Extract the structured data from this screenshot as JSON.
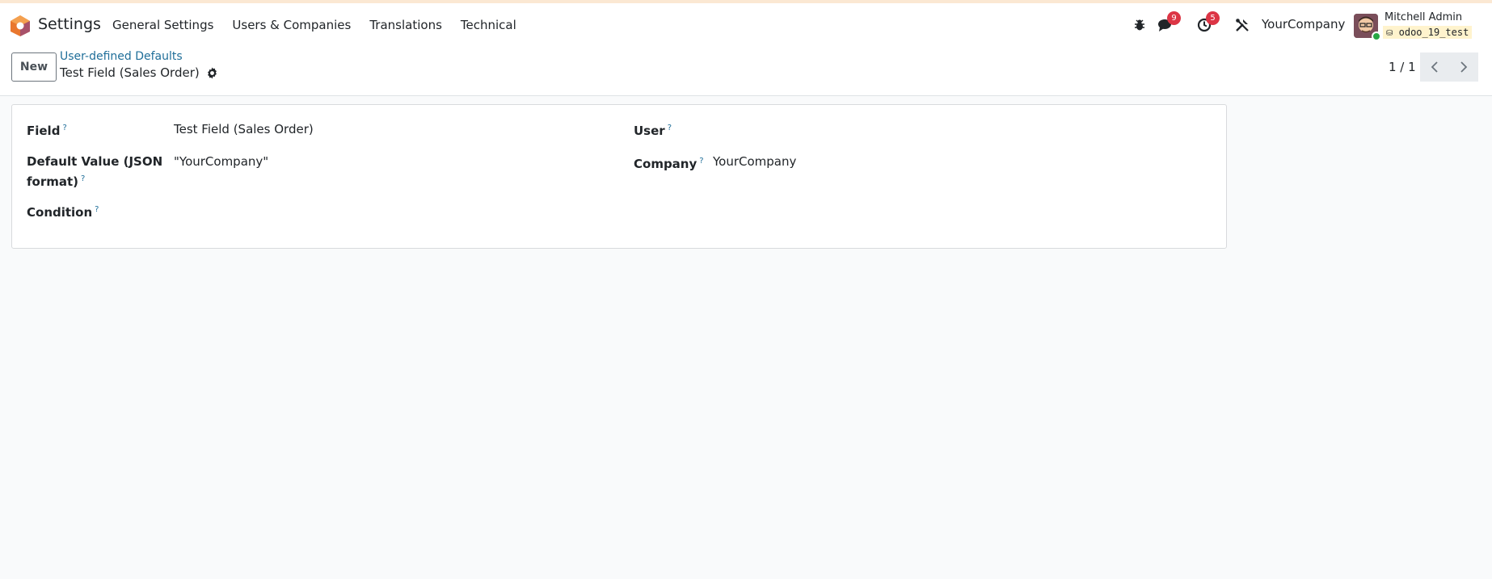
{
  "navbar": {
    "app_name": "Settings",
    "menu": [
      "General Settings",
      "Users & Companies",
      "Translations",
      "Technical"
    ],
    "tray": {
      "bug_icon": "bug-icon",
      "messages_icon": "chat-icon",
      "messages_count": "9",
      "activity_icon": "clock-icon",
      "activity_count": "5",
      "tools_icon": "tools-icon",
      "company": "YourCompany",
      "user_name": "Mitchell Admin",
      "db_name": "odoo_19_test"
    }
  },
  "control_panel": {
    "new_label": "New",
    "breadcrumb_parent": "User-defined Defaults",
    "record_title": "Test Field (Sales Order)",
    "pager_value": "1 / 1"
  },
  "form": {
    "field_label": "Field",
    "field_value": "Test Field (Sales Order)",
    "default_value_label_line1": "Default Value (JSON",
    "default_value_label_line2": "format)",
    "default_value": "\"YourCompany\"",
    "condition_label": "Condition",
    "user_label": "User",
    "company_label": "Company",
    "company_value": "YourCompany",
    "help_mark": "?"
  },
  "colors": {
    "accent_link": "#1f6e99",
    "badge": "#dc3545",
    "online": "#28a745"
  }
}
